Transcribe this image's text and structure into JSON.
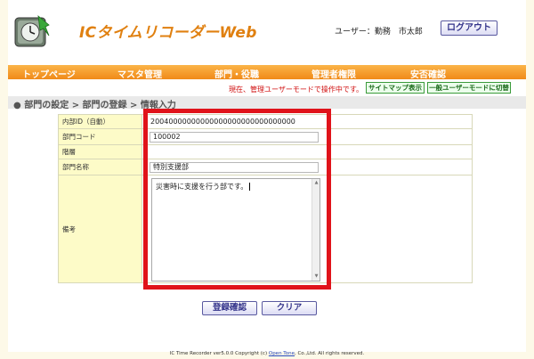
{
  "header": {
    "app_title": "ICタイムリコーダーWeb",
    "user_label": "ユーザー：勤務　市太郎",
    "logout_label": "ログアウト"
  },
  "nav": {
    "items": [
      {
        "label": "トップページ"
      },
      {
        "label": "マスタ管理"
      },
      {
        "label": "部門・役職"
      },
      {
        "label": "管理者権限"
      },
      {
        "label": "安否確認"
      }
    ]
  },
  "mode": {
    "message": "現在、管理ユーザーモードで操作中です。",
    "sitemap_label": "サイトマップ表示",
    "user_mode_label": "一般ユーザーモードに切替"
  },
  "breadcrumb": {
    "text": "● 部門の設定 > 部門の登録 > 情報入力"
  },
  "form": {
    "fields": [
      {
        "label": "内部ID（自動）",
        "value": "20040000000000000000000000000000"
      },
      {
        "label": "部門コード",
        "value": "100002"
      },
      {
        "label": "階層",
        "value": ""
      },
      {
        "label": "部門名称",
        "value": "特別支援部"
      },
      {
        "label": "備考",
        "value": "災害時に支援を行う部です。"
      }
    ]
  },
  "actions": {
    "confirm_label": "登録確認",
    "clear_label": "クリア"
  },
  "footer": {
    "prefix": "IC Time Recorder ver5.0.0 Copyright (c) ",
    "link": "Open Tone",
    "suffix": ", Co.,Ltd. All rights reserved."
  },
  "colors": {
    "accent_orange": "#f08a18",
    "highlight_red": "#e0131a",
    "label_bg": "#fdfbc8",
    "mode_text_red": "#d01010"
  }
}
